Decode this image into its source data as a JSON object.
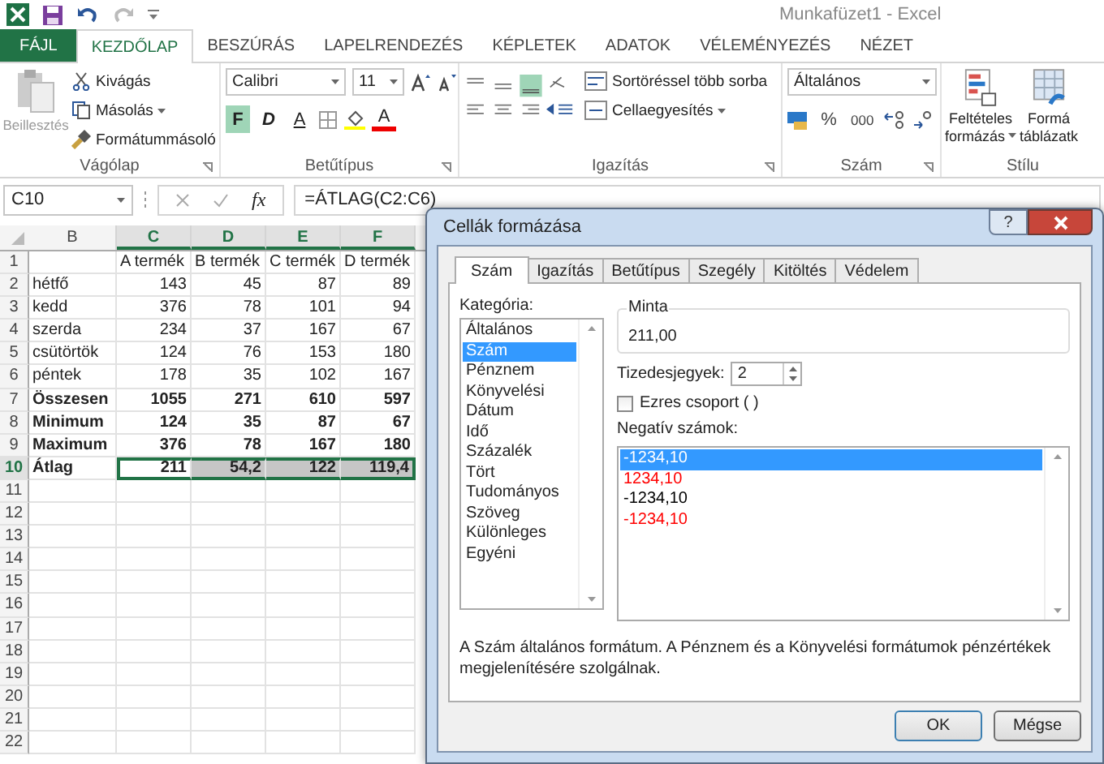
{
  "window": {
    "title": "Munkafüzet1 - Excel"
  },
  "ribbon_tabs": [
    {
      "label": "FÁJL",
      "kind": "file",
      "selected": false
    },
    {
      "label": "KEZDŐLAP",
      "kind": "tab",
      "selected": true
    },
    {
      "label": "BESZÚRÁS",
      "kind": "tab",
      "selected": false
    },
    {
      "label": "LAPELRENDEZÉS",
      "kind": "tab",
      "selected": false
    },
    {
      "label": "KÉPLETEK",
      "kind": "tab",
      "selected": false
    },
    {
      "label": "ADATOK",
      "kind": "tab",
      "selected": false
    },
    {
      "label": "VÉLEMÉNYEZÉS",
      "kind": "tab",
      "selected": false
    },
    {
      "label": "NÉZET",
      "kind": "tab",
      "selected": false
    }
  ],
  "clipboard": {
    "paste": "Beillesztés",
    "cut": "Kivágás",
    "copy": "Másolás",
    "format_painter": "Formátummásoló",
    "group": "Vágólap"
  },
  "font": {
    "name": "Calibri",
    "size": "11",
    "bold": "F",
    "bold_on": true,
    "italic": "D",
    "underline": "A",
    "font_color": "A",
    "group": "Betűtípus"
  },
  "alignment": {
    "wrap": "Sortöréssel több sorba",
    "merge": "Cellaegyesítés",
    "group": "Igazítás"
  },
  "number": {
    "format": "Általános",
    "percent": "%",
    "thousands": "000",
    "group": "Szám"
  },
  "styles": {
    "conditional_line1": "Feltételes",
    "conditional_line2": "formázás",
    "table_line1": "Formá",
    "table_line2": "táblázatk",
    "group": "Stílu"
  },
  "formula_bar": {
    "name_box": "C10",
    "fx": "fx",
    "formula": "=ÁTLAG(C2:C6)"
  },
  "sheet": {
    "columns": [
      {
        "label": "B",
        "selected": false
      },
      {
        "label": "C",
        "selected": true
      },
      {
        "label": "D",
        "selected": true
      },
      {
        "label": "E",
        "selected": true
      },
      {
        "label": "F",
        "selected": true
      }
    ],
    "rows": [
      {
        "num": "1",
        "kind": "header",
        "selected": false,
        "values": [
          "A termék",
          "B termék",
          "C termék",
          "D termék"
        ]
      },
      {
        "num": "2",
        "kind": "data",
        "selected": false,
        "bold": false,
        "label": "hétfő",
        "values": [
          "143",
          "45",
          "87",
          "89"
        ]
      },
      {
        "num": "3",
        "kind": "data",
        "selected": false,
        "bold": false,
        "label": "kedd",
        "values": [
          "376",
          "78",
          "101",
          "94"
        ]
      },
      {
        "num": "4",
        "kind": "data",
        "selected": false,
        "bold": false,
        "label": "szerda",
        "values": [
          "234",
          "37",
          "167",
          "67"
        ]
      },
      {
        "num": "5",
        "kind": "data",
        "selected": false,
        "bold": false,
        "label": "csütörtök",
        "values": [
          "124",
          "76",
          "153",
          "180"
        ]
      },
      {
        "num": "6",
        "kind": "data",
        "selected": false,
        "bold": false,
        "label": "péntek",
        "values": [
          "178",
          "35",
          "102",
          "167"
        ]
      },
      {
        "num": "7",
        "kind": "data",
        "selected": false,
        "bold": true,
        "label": "Összesen",
        "values": [
          "1055",
          "271",
          "610",
          "597"
        ]
      },
      {
        "num": "8",
        "kind": "data",
        "selected": false,
        "bold": true,
        "label": "Minimum",
        "values": [
          "124",
          "35",
          "87",
          "67"
        ]
      },
      {
        "num": "9",
        "kind": "data",
        "selected": false,
        "bold": true,
        "label": "Maximum",
        "values": [
          "376",
          "78",
          "167",
          "180"
        ]
      },
      {
        "num": "10",
        "kind": "data",
        "selected": true,
        "bold": true,
        "label": "Átlag",
        "values": [
          "211",
          "54,2",
          "122",
          "119,4"
        ]
      },
      {
        "num": "11",
        "kind": "empty",
        "selected": false
      },
      {
        "num": "12",
        "kind": "empty",
        "selected": false
      },
      {
        "num": "13",
        "kind": "empty",
        "selected": false
      },
      {
        "num": "14",
        "kind": "empty",
        "selected": false
      },
      {
        "num": "15",
        "kind": "empty",
        "selected": false
      },
      {
        "num": "16",
        "kind": "empty",
        "selected": false
      },
      {
        "num": "17",
        "kind": "empty",
        "selected": false
      },
      {
        "num": "18",
        "kind": "empty",
        "selected": false
      },
      {
        "num": "19",
        "kind": "empty",
        "selected": false
      },
      {
        "num": "20",
        "kind": "empty",
        "selected": false
      },
      {
        "num": "21",
        "kind": "empty",
        "selected": false
      },
      {
        "num": "22",
        "kind": "empty",
        "selected": false
      }
    ]
  },
  "dialog": {
    "title": "Cellák formázása",
    "help": "?",
    "tabs": [
      {
        "label": "Szám",
        "selected": true
      },
      {
        "label": "Igazítás",
        "selected": false
      },
      {
        "label": "Betűtípus",
        "selected": false
      },
      {
        "label": "Szegély",
        "selected": false
      },
      {
        "label": "Kitöltés",
        "selected": false
      },
      {
        "label": "Védelem",
        "selected": false
      }
    ],
    "category_label": "Kategória:",
    "categories": [
      {
        "label": "Általános",
        "selected": false
      },
      {
        "label": "Szám",
        "selected": true
      },
      {
        "label": "Pénznem",
        "selected": false
      },
      {
        "label": "Könyvelési",
        "selected": false
      },
      {
        "label": "Dátum",
        "selected": false
      },
      {
        "label": "Idő",
        "selected": false
      },
      {
        "label": "Százalék",
        "selected": false
      },
      {
        "label": "Tört",
        "selected": false
      },
      {
        "label": "Tudományos",
        "selected": false
      },
      {
        "label": "Szöveg",
        "selected": false
      },
      {
        "label": "Különleges",
        "selected": false
      },
      {
        "label": "Egyéni",
        "selected": false
      }
    ],
    "sample_label": "Minta",
    "sample": "211,00",
    "decimals_label": "Tizedesjegyek:",
    "decimals": "2",
    "thousands_label": "Ezres csoport ( )",
    "thousands_checked": false,
    "negative_label": "Negatív számok:",
    "negatives": [
      {
        "label": "-1234,10",
        "selected": true
      },
      {
        "label": "1234,10",
        "color": "#ff0000",
        "selected": false
      },
      {
        "label": "-1234,10",
        "color": "#000000",
        "selected": false
      },
      {
        "label": "-1234,10",
        "color": "#ff0000",
        "selected": false
      }
    ],
    "description": "A Szám általános formátum. A Pénznem és a Könyvelési formátumok pénzértékek megjelenítésére szolgálnak.",
    "buttons": [
      {
        "label": "OK",
        "kind": "default"
      },
      {
        "label": "Mégse",
        "kind": "normal"
      }
    ]
  }
}
